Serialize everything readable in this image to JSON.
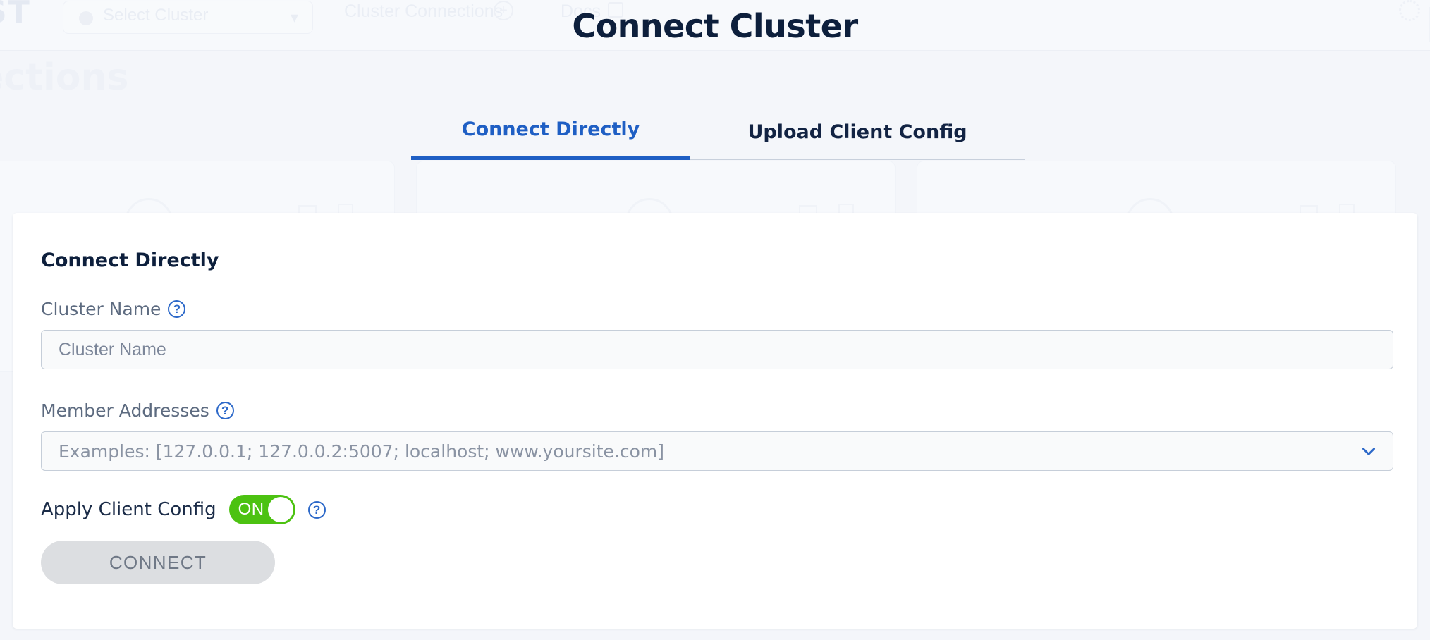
{
  "background": {
    "brand": "ST",
    "cluster_select_placeholder": "Select Cluster",
    "breadcrumb_1": "Cluster Connections",
    "breadcrumb_2": "Docs",
    "page_title": "ections"
  },
  "modal": {
    "title": "Connect Cluster",
    "tabs": [
      {
        "label": "Connect Directly",
        "active": true
      },
      {
        "label": "Upload Client Config",
        "active": false
      }
    ],
    "panel": {
      "heading": "Connect Directly",
      "fields": [
        {
          "label": "Cluster Name",
          "help_icon": "help-circle-icon",
          "placeholder": "Cluster Name",
          "value": ""
        },
        {
          "label": "Member Addresses",
          "help_icon": "help-circle-icon",
          "placeholder": "Examples: [127.0.0.1; 127.0.0.2:5007; localhost; www.yoursite.com]",
          "value": "",
          "dropdown_icon": "chevron-down-icon"
        }
      ],
      "toggle": {
        "label": "Apply Client Config",
        "state_text": "ON",
        "checked": true,
        "help_icon": "help-circle-icon"
      },
      "submit_label": "CONNECT",
      "submit_disabled": true
    }
  },
  "colors": {
    "accent_blue": "#1f5fc4",
    "title_navy": "#0d1f3c",
    "toggle_green": "#4cc211",
    "disabled_gray": "#dcdee1",
    "page_bg": "#f4f6fa",
    "panel_bg": "#ffffff"
  }
}
